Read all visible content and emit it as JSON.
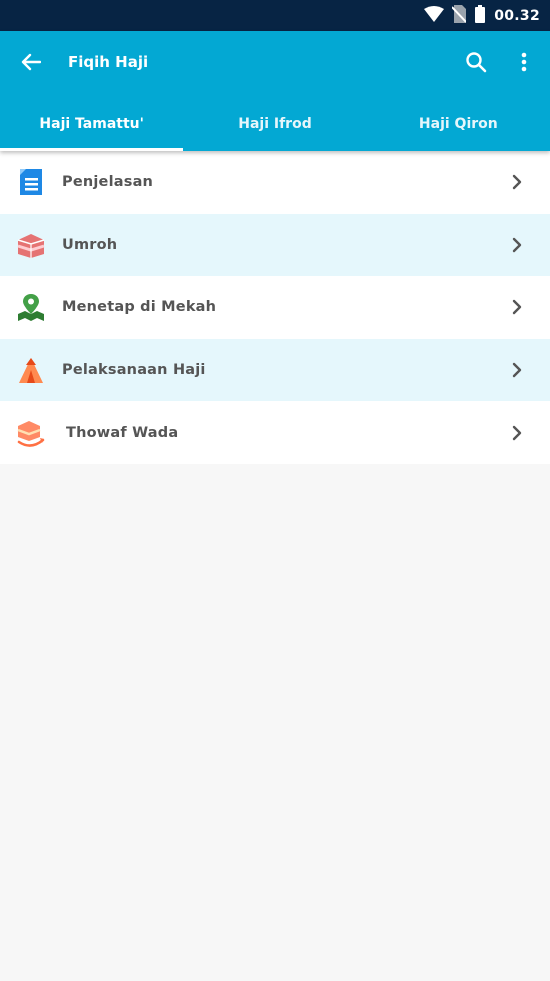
{
  "status_bar": {
    "time": "00.32",
    "icons": [
      "wifi-icon",
      "no-sim-icon",
      "battery-icon"
    ]
  },
  "toolbar": {
    "title": "Fiqih Haji",
    "back_icon": "arrow-left-icon",
    "search_icon": "search-icon",
    "more_icon": "more-vert-icon"
  },
  "tabs": [
    {
      "label": "Haji Tamattu'",
      "active": true
    },
    {
      "label": "Haji Ifrod",
      "active": false
    },
    {
      "label": "Haji Qiron",
      "active": false
    }
  ],
  "list": {
    "items": [
      {
        "label": "Penjelasan",
        "icon": "document-icon"
      },
      {
        "label": "Umroh",
        "icon": "kaaba-icon"
      },
      {
        "label": "Menetap di Mekah",
        "icon": "map-pin-icon"
      },
      {
        "label": "Pelaksanaan Haji",
        "icon": "tent-icon"
      },
      {
        "label": "Thowaf Wada",
        "icon": "tawaf-icon"
      }
    ]
  },
  "colors": {
    "status_bar": "#072444",
    "primary": "#03a8d3",
    "row_alt": "#e5f7fc",
    "background": "#f7f7f7"
  }
}
